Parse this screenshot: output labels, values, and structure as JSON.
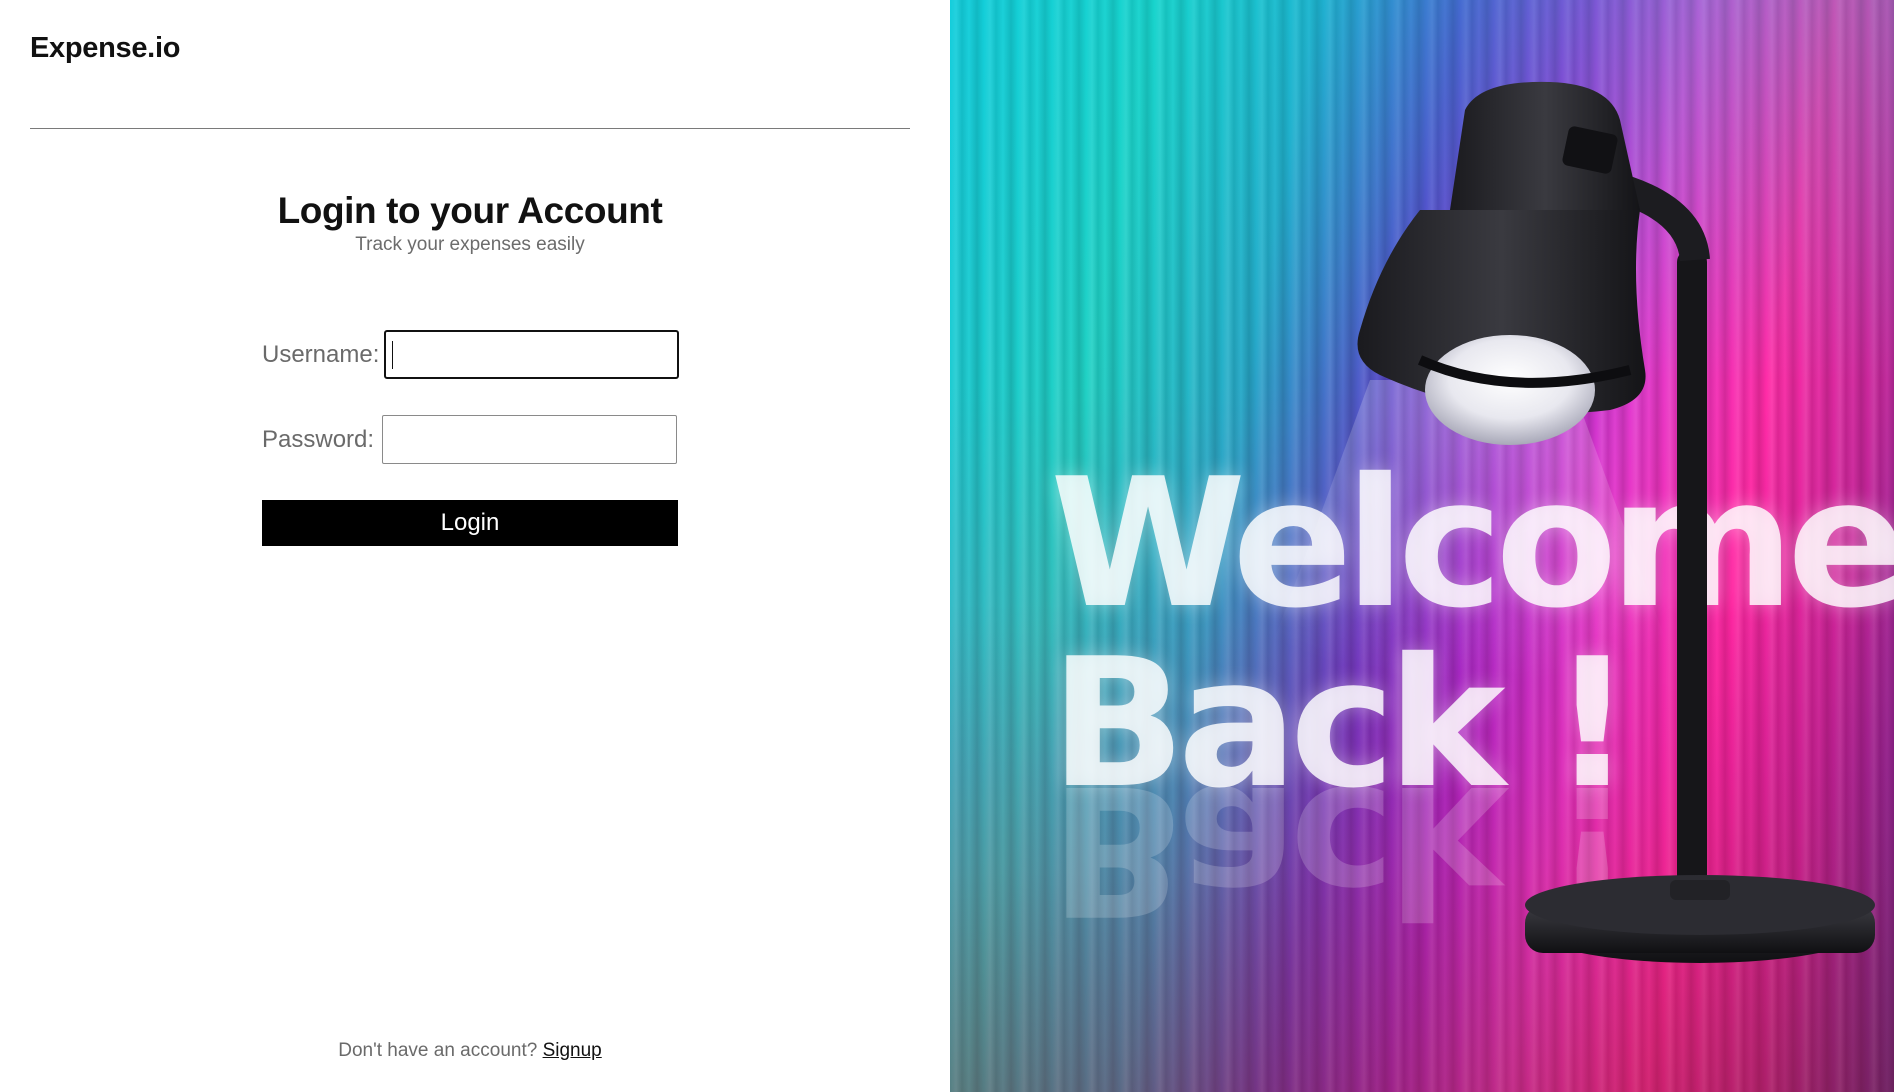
{
  "brand": {
    "name": "Expense.io"
  },
  "login": {
    "title": "Login to your Account",
    "subtitle": "Track your expenses easily",
    "username_label": "Username:",
    "username_value": "",
    "password_label": "Password:",
    "password_value": "",
    "submit_label": "Login"
  },
  "footer": {
    "prompt": "Don't have an account?",
    "signup_label": "Signup"
  },
  "hero": {
    "line1": "Welcome",
    "line2": "Back !",
    "icon": "desk-lamp-icon"
  },
  "colors": {
    "button_bg": "#000000",
    "button_text": "#ffffff",
    "label_text": "#6a6a6a"
  }
}
